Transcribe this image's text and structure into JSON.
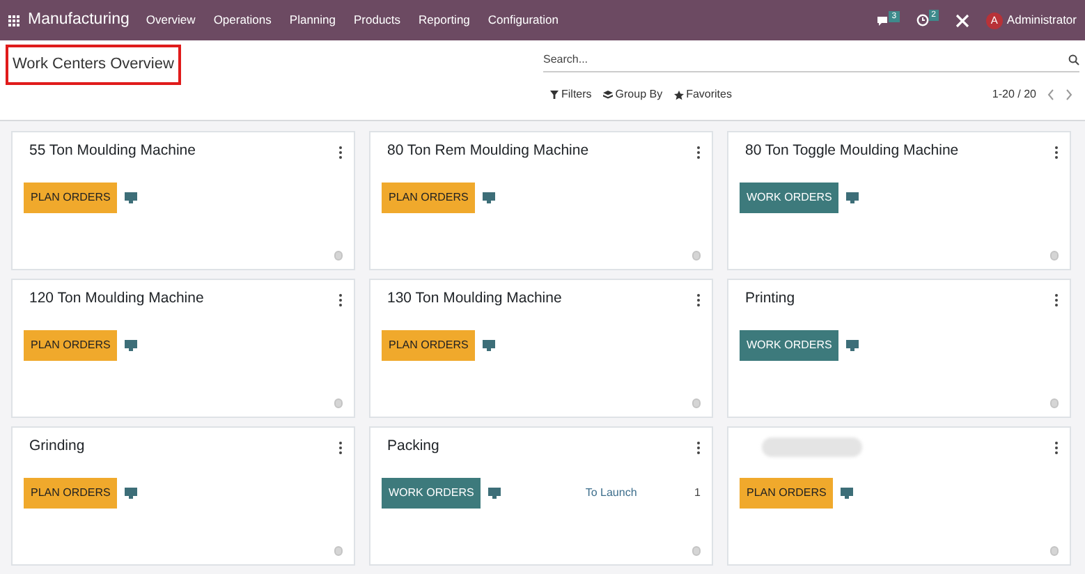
{
  "navbar": {
    "app": "Manufacturing",
    "menu": [
      "Overview",
      "Operations",
      "Planning",
      "Products",
      "Reporting",
      "Configuration"
    ],
    "messages_count": "3",
    "activities_count": "2",
    "user_initial": "A",
    "user": "Administrator"
  },
  "control_panel": {
    "title": "Work Centers Overview",
    "search": {
      "placeholder": "Search..."
    },
    "filters": [
      "Filters",
      "Group By",
      "Favorites"
    ],
    "pager": "1-20 / 20"
  },
  "cards": [
    {
      "title": "55 Ton Moulding Machine",
      "button": {
        "kind": "plan",
        "label": "PLAN ORDERS"
      }
    },
    {
      "title": "80 Ton Rem Moulding Machine",
      "button": {
        "kind": "plan",
        "label": "PLAN ORDERS"
      }
    },
    {
      "title": "80 Ton Toggle Moulding Machine",
      "button": {
        "kind": "work",
        "label": "WORK ORDERS"
      }
    },
    {
      "title": "120 Ton Moulding Machine",
      "button": {
        "kind": "plan",
        "label": "PLAN ORDERS"
      }
    },
    {
      "title": "130 Ton Moulding Machine",
      "button": {
        "kind": "plan",
        "label": "PLAN ORDERS"
      }
    },
    {
      "title": "Printing",
      "button": {
        "kind": "work",
        "label": "WORK ORDERS"
      }
    },
    {
      "title": "Grinding",
      "button": {
        "kind": "plan",
        "label": "PLAN ORDERS"
      }
    },
    {
      "title": "Packing",
      "button": {
        "kind": "work",
        "label": "WORK ORDERS"
      },
      "stat": {
        "label": "To Launch",
        "value": "1"
      }
    },
    {
      "title_redacted": true,
      "button": {
        "kind": "plan",
        "label": "PLAN ORDERS"
      }
    }
  ]
}
